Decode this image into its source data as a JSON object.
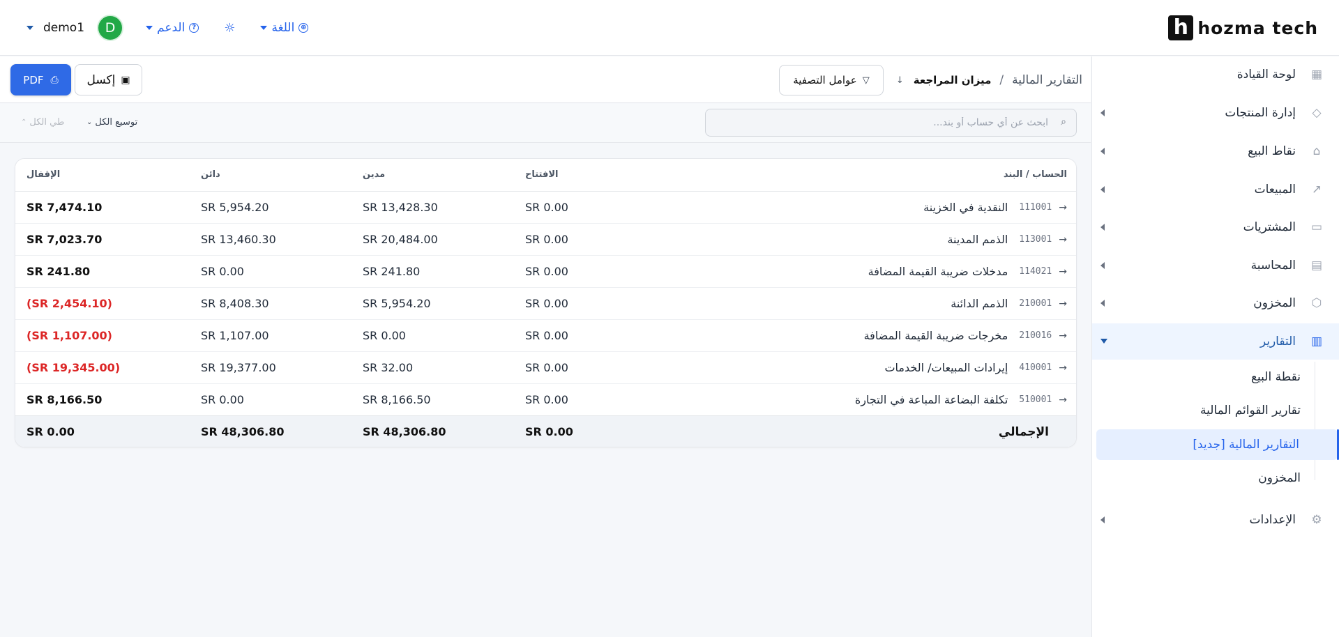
{
  "header": {
    "logo_mark": "h",
    "logo_text": "hozma tech",
    "language_label": "اللغة",
    "support_label": "الدعم",
    "avatar_letter": "D",
    "username": "demo1"
  },
  "sidebar": {
    "items": [
      {
        "label": "لوحة القيادة",
        "icon": "dashboard-icon",
        "glyph": "▦"
      },
      {
        "label": "إدارة المنتجات",
        "icon": "tag-icon",
        "glyph": "◇"
      },
      {
        "label": "نقاط البيع",
        "icon": "store-icon",
        "glyph": "⌂"
      },
      {
        "label": "المبيعات",
        "icon": "chart-icon",
        "glyph": "↗"
      },
      {
        "label": "المشتريات",
        "icon": "wallet-icon",
        "glyph": "▭"
      },
      {
        "label": "المحاسبة",
        "icon": "ledger-icon",
        "glyph": "▤"
      },
      {
        "label": "المخزون",
        "icon": "box-icon",
        "glyph": "⬡"
      },
      {
        "label": "التقارير",
        "icon": "report-icon",
        "glyph": "▥"
      },
      {
        "label": "الإعدادات",
        "icon": "gear-icon",
        "glyph": "⚙"
      }
    ],
    "report_sub": [
      {
        "label": "نقطة البيع"
      },
      {
        "label": "تقارير القوائم المالية"
      },
      {
        "label": "التقارير المالية [جديد]"
      },
      {
        "label": "المخزون"
      }
    ]
  },
  "toolbar": {
    "breadcrumb_root": "التقارير المالية",
    "breadcrumb_sep": "/",
    "breadcrumb_current": "ميزان المراجعة",
    "filter_label": "عوامل التصفية",
    "pdf_label": "PDF",
    "excel_label": "إكسل"
  },
  "search": {
    "placeholder": "ابحث عن أي حساب أو بند...",
    "expand_all": "توسيع الكل",
    "collapse_all": "طي الكل"
  },
  "table": {
    "columns": {
      "account": "الحساب / البند",
      "opening": "الافتتاح",
      "debit": "مدين",
      "credit": "دائن",
      "closing": "الإقفال"
    },
    "rows": [
      {
        "code": "111001",
        "name": "النقدية في الخزينة",
        "opening": "SR 0.00",
        "debit": "SR 13,428.30",
        "credit": "SR 5,954.20",
        "closing": "SR 7,474.10",
        "negative": false
      },
      {
        "code": "113001",
        "name": "الذمم المدينة",
        "opening": "SR 0.00",
        "debit": "SR 20,484.00",
        "credit": "SR 13,460.30",
        "closing": "SR 7,023.70",
        "negative": false
      },
      {
        "code": "114021",
        "name": "مدخلات ضريبة القيمة المضافة",
        "opening": "SR 0.00",
        "debit": "SR 241.80",
        "credit": "SR 0.00",
        "closing": "SR 241.80",
        "negative": false
      },
      {
        "code": "210001",
        "name": "الذمم الدائنة",
        "opening": "SR 0.00",
        "debit": "SR 5,954.20",
        "credit": "SR 8,408.30",
        "closing": "(SR 2,454.10)",
        "negative": true
      },
      {
        "code": "210016",
        "name": "مخرجات ضريبة القيمة المضافة",
        "opening": "SR 0.00",
        "debit": "SR 0.00",
        "credit": "SR 1,107.00",
        "closing": "(SR 1,107.00)",
        "negative": true
      },
      {
        "code": "410001",
        "name": "إيرادات المبيعات/ الخدمات",
        "opening": "SR 0.00",
        "debit": "SR 32.00",
        "credit": "SR 19,377.00",
        "closing": "(SR 19,345.00)",
        "negative": true
      },
      {
        "code": "510001",
        "name": "تكلفة البضاعة المباعة في التجارة",
        "opening": "SR 0.00",
        "debit": "SR 8,166.50",
        "credit": "SR 0.00",
        "closing": "SR 8,166.50",
        "negative": false
      }
    ],
    "total": {
      "label": "الإجمالي",
      "opening": "SR 0.00",
      "debit": "SR 48,306.80",
      "credit": "SR 48,306.80",
      "closing": "SR 0.00"
    }
  },
  "colors": {
    "accent": "#2563eb",
    "negative": "#dc2626",
    "avatar": "#22a846"
  }
}
